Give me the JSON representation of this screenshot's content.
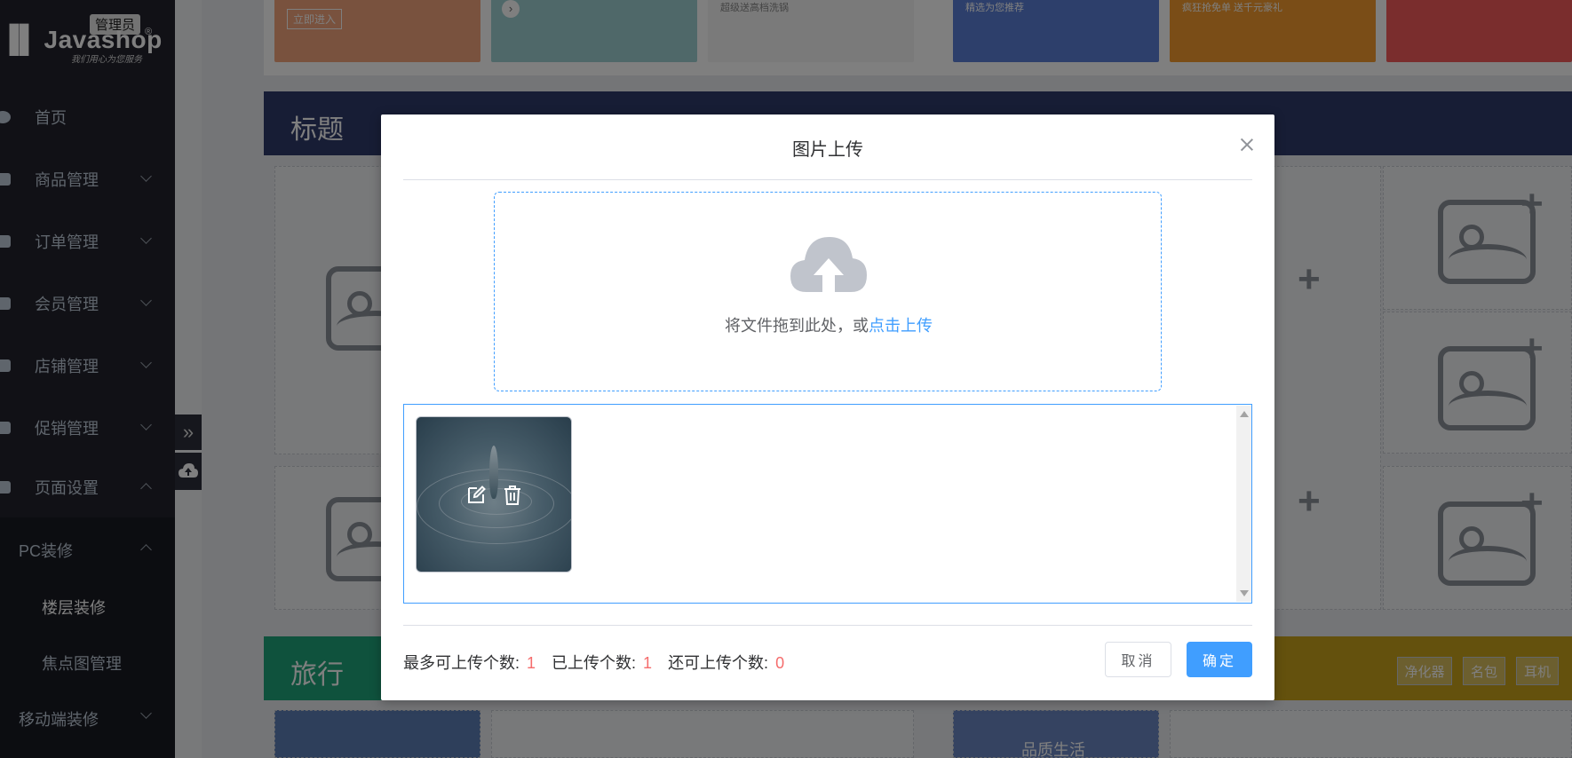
{
  "sidebar": {
    "logo": {
      "badge": "管理员",
      "brand": "Javashop",
      "registered": "®",
      "slogan": "我们用心为您服务"
    },
    "items": [
      {
        "label": "首页"
      },
      {
        "label": "商品管理"
      },
      {
        "label": "订单管理"
      },
      {
        "label": "会员管理"
      },
      {
        "label": "店铺管理"
      },
      {
        "label": "促销管理"
      },
      {
        "label": "页面设置"
      }
    ],
    "submenu": {
      "group": "PC装修",
      "items": [
        {
          "label": "楼层装修"
        },
        {
          "label": "焦点图管理"
        }
      ],
      "next_group": "移动端装修"
    },
    "collapse_glyph": "»"
  },
  "background": {
    "banners": [
      {
        "text": "立即进入",
        "color": "#f3a47c"
      },
      {
        "text": "",
        "color": "#9ed0d2"
      },
      {
        "text": "超级送高档洗锅",
        "color": "#f5f5f5"
      },
      {
        "text": "精选为您推荐",
        "color": "#5b7fd6"
      },
      {
        "text": "疯狂抢免单 送千元豪礼",
        "color": "#f49a2e"
      },
      {
        "text": "",
        "color": "#f45a5a"
      }
    ],
    "floor1_title": "标题",
    "floor1_color": "#2f3a6b",
    "floor2_title": "旅行",
    "floor2_color": "#1fa47a",
    "floor2_right_color": "#c9a21a",
    "floor2_tags": [
      "净化器",
      "名包",
      "耳机"
    ],
    "bottom_tile_text": "品质生活"
  },
  "dialog": {
    "title": "图片上传",
    "dropzone": {
      "text": "将文件拖到此处，或",
      "link": "点击上传"
    },
    "counts": {
      "max_label": "最多可上传个数:",
      "max_value": "1",
      "uploaded_label": "已上传个数:",
      "uploaded_value": "1",
      "remaining_label": "还可上传个数:",
      "remaining_value": "0"
    },
    "buttons": {
      "cancel": "取消",
      "confirm": "确定"
    }
  },
  "colors": {
    "primary": "#409eff",
    "danger": "#f56c6c",
    "sidebar": "#22232d"
  }
}
